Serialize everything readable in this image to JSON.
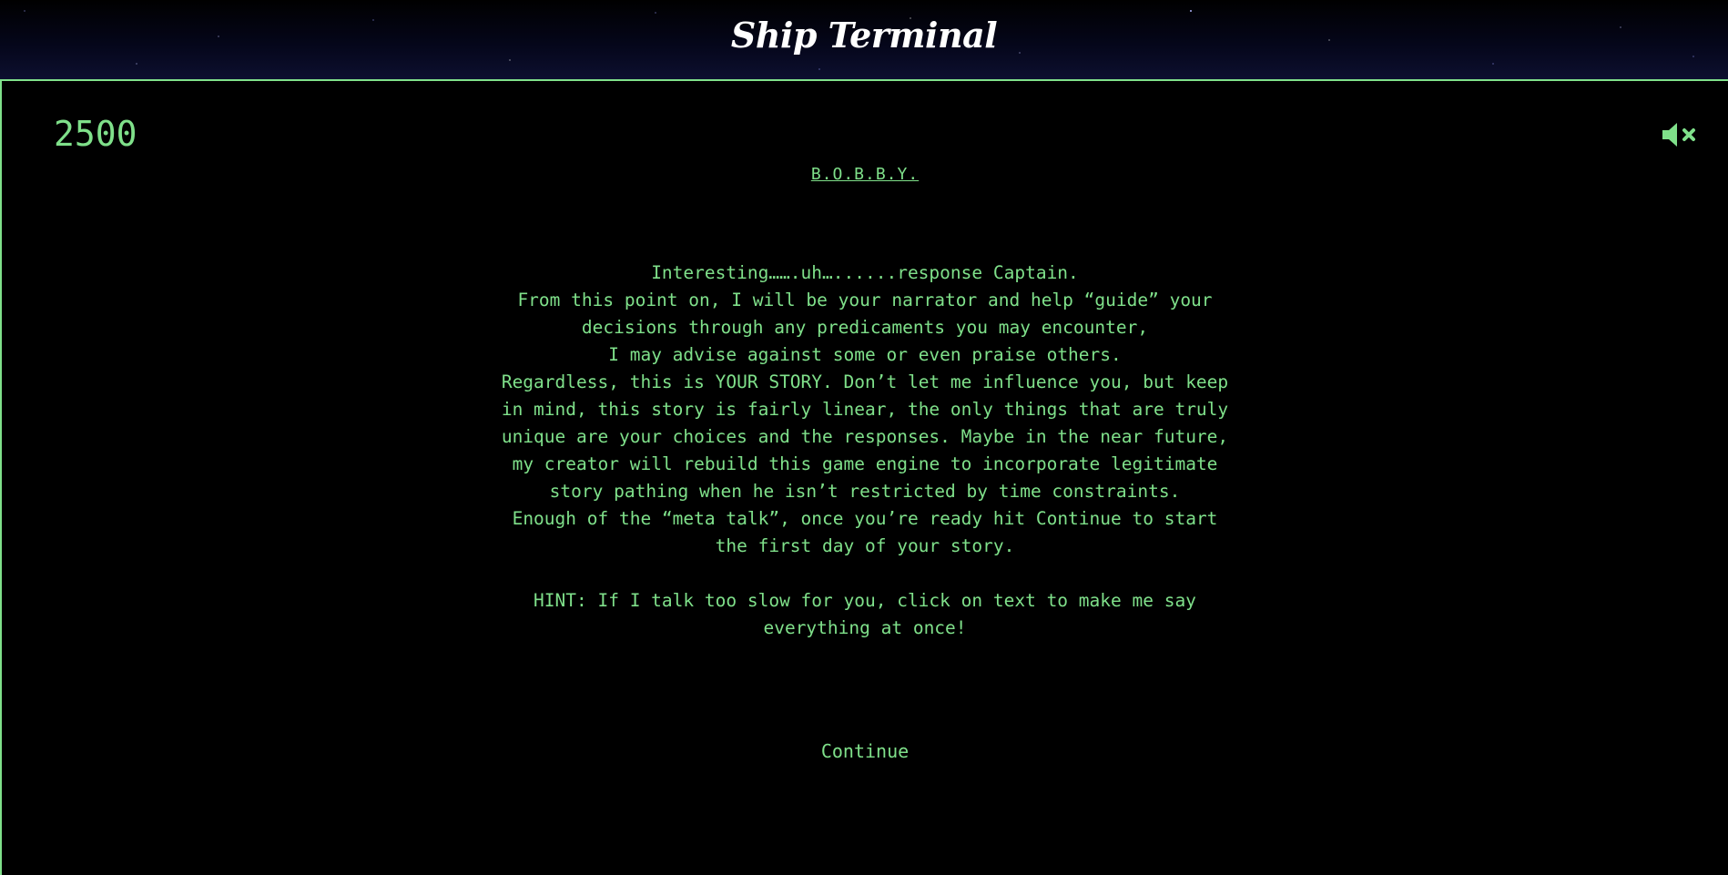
{
  "header": {
    "title": "Ship Terminal"
  },
  "terminal": {
    "score": "2500",
    "mute_icon": "speaker-muted-icon",
    "speaker": "B.O.B.B.Y.",
    "story_lines": [
      "Interesting…….uh…......response Captain.",
      "From this point on, I will be your narrator and help “guide” your decisions through any predicaments you may encounter,",
      "I may advise against some or even praise others.",
      "Regardless, this is YOUR STORY. Don’t let me influence you, but keep in mind, this story is fairly linear, the only things that are truly unique are your choices and the responses. Maybe in the near future, my creator will rebuild this game engine to incorporate legitimate story pathing when he isn’t restricted by time constraints.",
      "Enough of the “meta talk”, once you’re ready hit Continue to start the first day of your story."
    ],
    "hint": "HINT: If I talk too slow for you, click on text to make me say everything at once!",
    "continue_label": "Continue"
  },
  "colors": {
    "terminal_green": "#7fe08a",
    "background": "#000000",
    "title": "#ffffff"
  }
}
